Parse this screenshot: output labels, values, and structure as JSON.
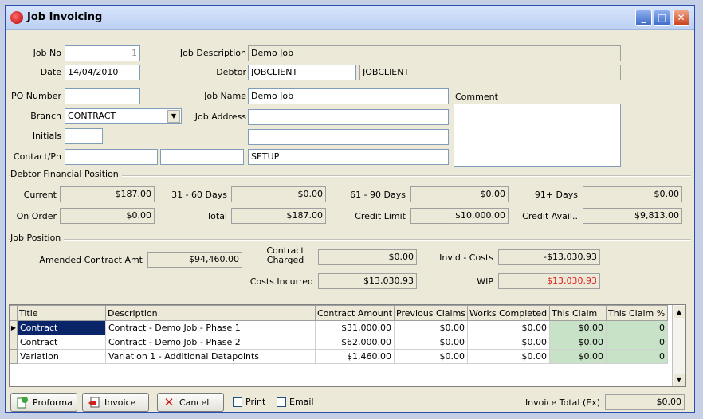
{
  "window": {
    "title": "Job Invoicing",
    "min": "_",
    "max": "□",
    "close": "✕"
  },
  "header": {
    "job_no_label": "Job No",
    "job_no": "1",
    "date_label": "Date",
    "date": "14/04/2010",
    "po_label": "PO Number",
    "po": "",
    "branch_label": "Branch",
    "branch": "CONTRACT",
    "initials_label": "Initials",
    "initials": "",
    "contact_label": "Contact/Ph",
    "contact": "",
    "phone": "",
    "job_desc_label": "Job Description",
    "job_desc": "Demo Job",
    "debtor_label": "Debtor",
    "debtor_code": "JOBCLIENT",
    "debtor_name": "JOBCLIENT",
    "job_name_label": "Job Name",
    "job_name": "Demo Job",
    "job_address_label": "Job Address",
    "job_address_1": "",
    "job_address_2": "",
    "job_address_3": "SETUP",
    "comment_label": "Comment",
    "comment": ""
  },
  "debtor_position": {
    "title": "Debtor Financial Position",
    "current_label": "Current",
    "current": "$187.00",
    "d31_label": "31 - 60 Days",
    "d31": "$0.00",
    "d61_label": "61 - 90 Days",
    "d61": "$0.00",
    "d91_label": "91+ Days",
    "d91": "$0.00",
    "on_order_label": "On Order",
    "on_order": "$0.00",
    "total_label": "Total",
    "total": "$187.00",
    "credit_limit_label": "Credit Limit",
    "credit_limit": "$10,000.00",
    "credit_avail_label": "Credit Avail..",
    "credit_avail": "$9,813.00"
  },
  "job_position": {
    "title": "Job Position",
    "amended_label": "Amended Contract Amt",
    "amended": "$94,460.00",
    "contract_charged_label_1": "Contract",
    "contract_charged_label_2": "Charged",
    "contract_charged": "$0.00",
    "invd_costs_label": "Inv'd - Costs",
    "invd_costs": "-$13,030.93",
    "costs_incurred_label": "Costs Incurred",
    "costs_incurred": "$13,030.93",
    "wip_label": "WIP",
    "wip": "$13,030.93"
  },
  "grid": {
    "columns": [
      "Title",
      "Description",
      "Contract Amount",
      "Previous Claims",
      "Works Completed",
      "This Claim",
      "This Claim %"
    ],
    "rows": [
      {
        "title": "Contract",
        "description": "Contract - Demo Job - Phase 1",
        "contract_amount": "$31,000.00",
        "previous_claims": "$0.00",
        "works_completed": "$0.00",
        "this_claim": "$0.00",
        "this_claim_pct": "0"
      },
      {
        "title": "Contract",
        "description": "Contract - Demo Job - Phase 2",
        "contract_amount": "$62,000.00",
        "previous_claims": "$0.00",
        "works_completed": "$0.00",
        "this_claim": "$0.00",
        "this_claim_pct": "0"
      },
      {
        "title": "Variation",
        "description": "Variation 1 - Additional Datapoints",
        "contract_amount": "$1,460.00",
        "previous_claims": "$0.00",
        "works_completed": "$0.00",
        "this_claim": "$0.00",
        "this_claim_pct": "0"
      }
    ]
  },
  "footer": {
    "proforma": "Proforma",
    "invoice": "Invoice",
    "cancel": "Cancel",
    "print": "Print",
    "email": "Email",
    "invoice_total_label": "Invoice Total (Ex)",
    "invoice_total": "$0.00"
  }
}
